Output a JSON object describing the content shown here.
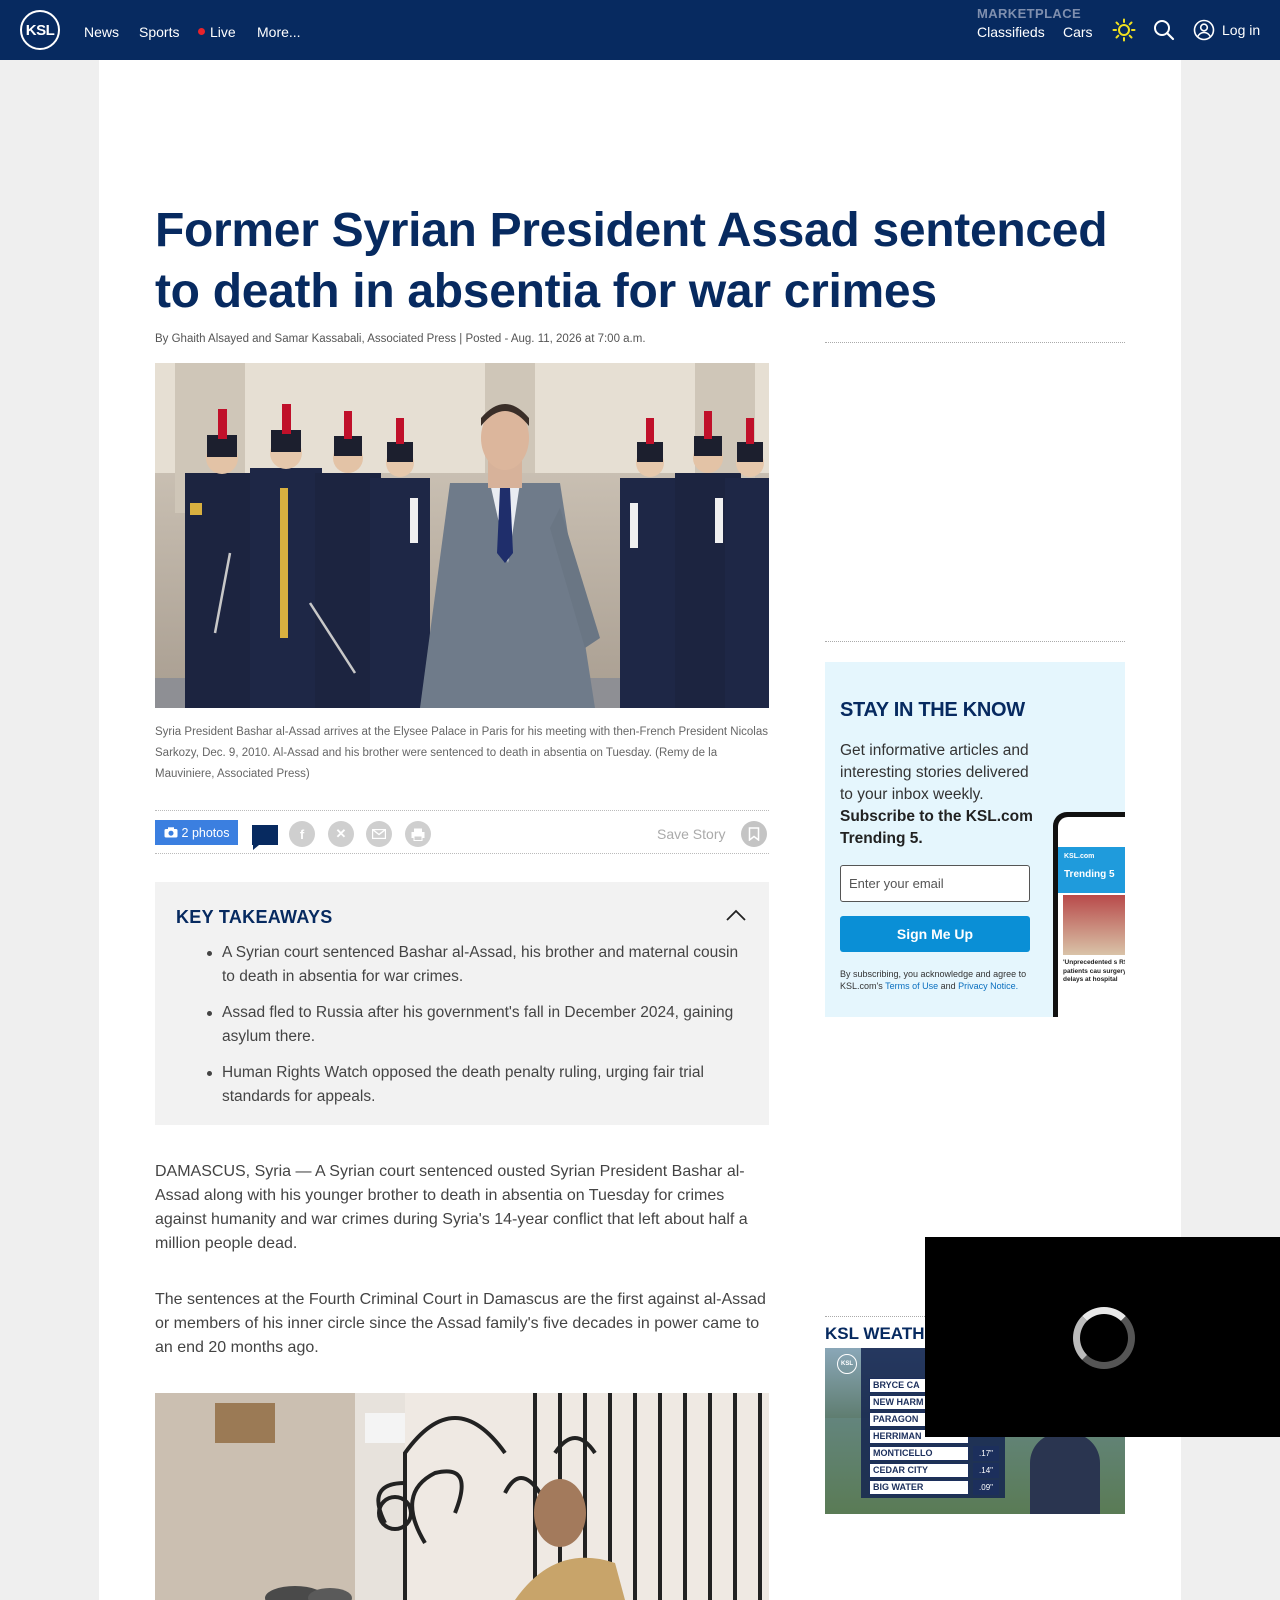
{
  "nav": {
    "logo": "KSL",
    "links": [
      "News",
      "Sports",
      "Live",
      "More..."
    ],
    "marketplace_label": "MARKETPLACE",
    "marketplace_links": [
      "Classifieds",
      "Cars"
    ],
    "login_label": "Log in",
    "icons": [
      "sun-icon",
      "search-icon",
      "user-icon"
    ]
  },
  "article": {
    "headline": "Former Syrian President Assad sentenced to death in absentia for war crimes",
    "byline": "By Ghaith Alsayed and Samar Kassabali, Associated Press | Posted - Aug. 11, 2026 at 7:00 a.m.",
    "caption": "Syria President Bashar al-Assad arrives at the Elysee Palace in Paris for his meeting with then-French President Nicolas Sarkozy, Dec. 9, 2010. Al-Assad and his brother were sentenced to death in absentia on Tuesday. (Remy de la Mauviniere, Associated Press)",
    "photos_label": "2 photos",
    "save_story": "Save Story",
    "share_icons": [
      "comment-icon",
      "facebook-icon",
      "x-icon",
      "email-icon",
      "print-icon",
      "bookmark-icon"
    ],
    "takeaways": {
      "title": "KEY TAKEAWAYS",
      "items": [
        "A Syrian court sentenced Bashar al-Assad, his brother and maternal cousin to death in absentia for war crimes.",
        "Assad fled to Russia after his government's fall in December 2024, gaining asylum there.",
        "Human Rights Watch opposed the death penalty ruling, urging fair trial standards for appeals."
      ]
    },
    "paragraphs": [
      "DAMASCUS, Syria — A Syrian court sentenced ousted Syrian President Bashar al-Assad along with his younger brother to death in absentia on Tuesday for crimes against humanity and war crimes during Syria's 14-year conflict that left about half a million people dead.",
      "The sentences at the Fourth Criminal Court in Damascus are the first against al-Assad or members of his inner circle since the Assad family's five decades in power came to an end 20 months ago."
    ]
  },
  "newsletter": {
    "title": "STAY IN THE KNOW",
    "text": "Get informative articles and interesting stories delivered to your inbox weekly.",
    "strong": "Subscribe to the KSL.com Trending 5.",
    "email_placeholder": "Enter your email",
    "button": "Sign Me Up",
    "legal_prefix": "By subscribing, you acknowledge and agree to KSL.com's",
    "legal_terms": "Terms of Use",
    "legal_and": "and",
    "legal_privacy": "Privacy Notice.",
    "phone_brand": "KSL.com",
    "phone_title": "Trending 5",
    "phone_headline": "'Unprecedented s RSV patients cau surgery delays at hospital"
  },
  "weather": {
    "title": "KSL WEATH",
    "rows": [
      {
        "name": "BRYCE CA",
        "value": ""
      },
      {
        "name": "NEW HARM",
        "value": ""
      },
      {
        "name": "PARAGON",
        "value": ""
      },
      {
        "name": "HERRIMAN",
        "value": ""
      },
      {
        "name": "MONTICELLO",
        "value": ".17\""
      },
      {
        "name": "CEDAR CITY",
        "value": ".14\""
      },
      {
        "name": "BIG WATER",
        "value": ".09\""
      }
    ]
  }
}
